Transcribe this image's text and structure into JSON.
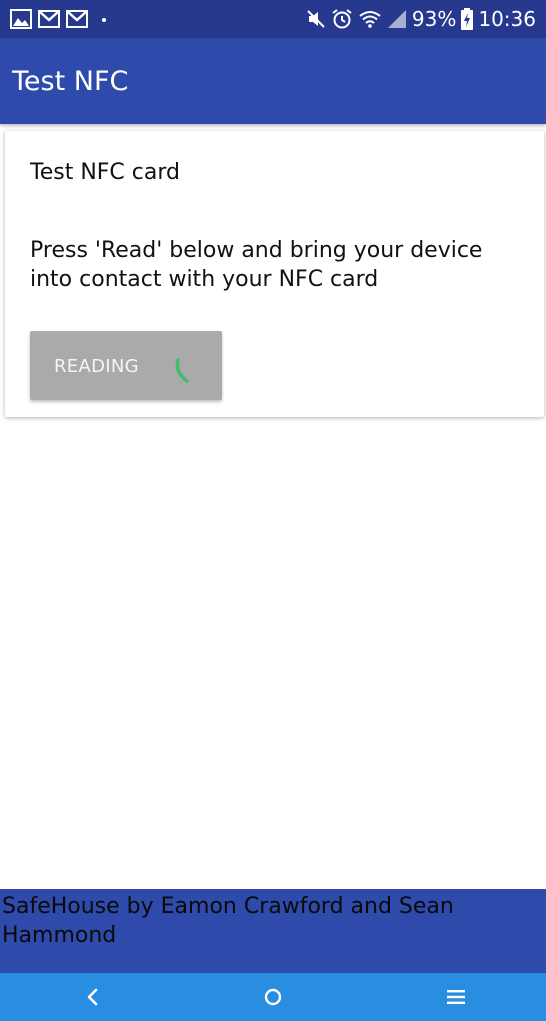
{
  "status_bar": {
    "battery_percent": "93%",
    "time": "10:36",
    "notification_icons": [
      "photo-icon",
      "gmail-icon",
      "gmail-icon",
      "dot-icon"
    ],
    "system_icons": [
      "mute-icon",
      "alarm-icon",
      "wifi-icon",
      "signal-icon",
      "battery-charging-icon"
    ]
  },
  "app_bar": {
    "title": "Test NFC"
  },
  "card": {
    "title": "Test NFC card",
    "body": "Press 'Read' below and bring your device into contact with your NFC card",
    "button_label": "READING",
    "spinner_color": "#3cc06a"
  },
  "footer": {
    "text": "SafeHouse by Eamon Crawford and Sean Hammond"
  },
  "nav_bar": {
    "buttons": [
      "back-icon",
      "home-icon",
      "recents-icon"
    ]
  },
  "colors": {
    "status_bar": "#27398f",
    "primary": "#2e4aab",
    "nav_bar": "#2a8ee0",
    "button_disabled": "#aaaaaa"
  }
}
